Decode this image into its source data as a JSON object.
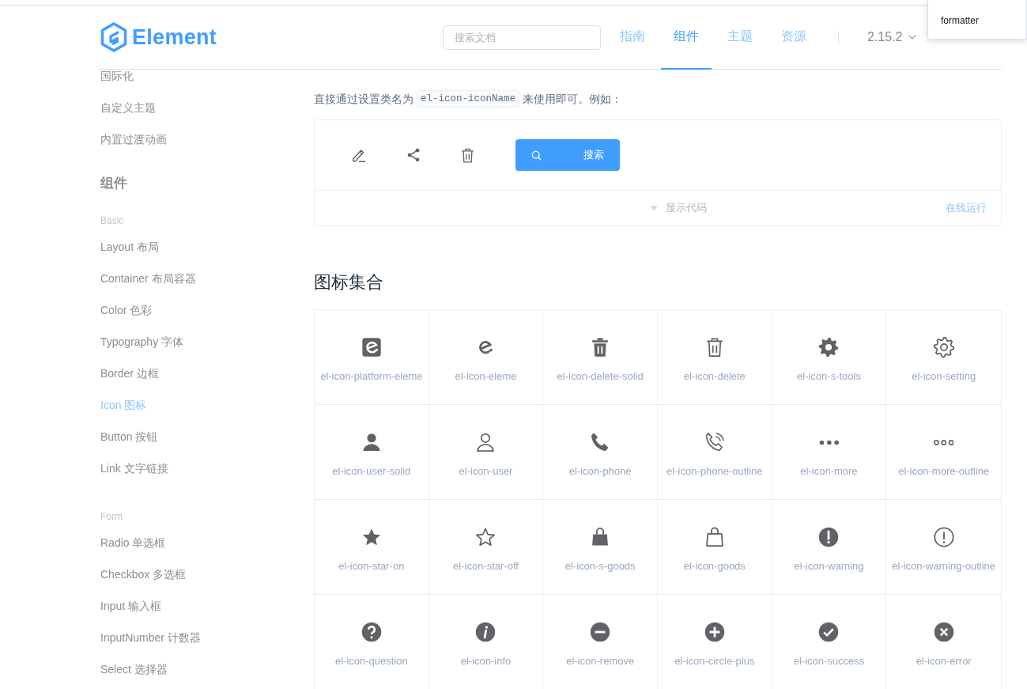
{
  "header": {
    "logo": "Element",
    "search": {
      "placeholder": "搜索文档"
    },
    "nav": [
      {
        "label": "指南",
        "selected": false
      },
      {
        "label": "组件",
        "selected": true
      },
      {
        "label": "主题",
        "selected": false
      },
      {
        "label": "资源",
        "selected": false
      }
    ],
    "version": "2.15.2"
  },
  "popup": {
    "text": "formatter"
  },
  "sidebar": {
    "items": [
      {
        "kind": "link",
        "label": "国际化",
        "selected": false
      },
      {
        "kind": "link",
        "label": "自定义主题",
        "selected": false
      },
      {
        "kind": "link",
        "label": "内置过渡动画",
        "selected": false
      },
      {
        "kind": "section",
        "label": "组件"
      },
      {
        "kind": "group",
        "label": "Basic"
      },
      {
        "kind": "link",
        "label": "Layout 布局",
        "selected": false
      },
      {
        "kind": "link",
        "label": "Container 布局容器",
        "selected": false
      },
      {
        "kind": "link",
        "label": "Color 色彩",
        "selected": false
      },
      {
        "kind": "link",
        "label": "Typography 字体",
        "selected": false
      },
      {
        "kind": "link",
        "label": "Border 边框",
        "selected": false
      },
      {
        "kind": "link",
        "label": "Icon 图标",
        "selected": true
      },
      {
        "kind": "link",
        "label": "Button 按钮",
        "selected": false
      },
      {
        "kind": "link",
        "label": "Link 文字链接",
        "selected": false
      },
      {
        "kind": "group",
        "label": "Form"
      },
      {
        "kind": "link",
        "label": "Radio 单选框",
        "selected": false
      },
      {
        "kind": "link",
        "label": "Checkbox 多选框",
        "selected": false
      },
      {
        "kind": "link",
        "label": "Input 输入框",
        "selected": false
      },
      {
        "kind": "link",
        "label": "InputNumber 计数器",
        "selected": false
      },
      {
        "kind": "link",
        "label": "Select 选择器",
        "selected": false
      }
    ]
  },
  "usage": {
    "text_before": "直接通过设置类名为",
    "code": "el-icon-iconName",
    "text_after": "来使用即可。例如："
  },
  "demo": {
    "button": "搜索",
    "show_code": "显示代码",
    "run_online": "在线运行"
  },
  "icon_section": {
    "title": "图标集合",
    "icons": [
      {
        "name": "el-icon-platform-eleme"
      },
      {
        "name": "el-icon-eleme"
      },
      {
        "name": "el-icon-delete-solid"
      },
      {
        "name": "el-icon-delete"
      },
      {
        "name": "el-icon-s-tools"
      },
      {
        "name": "el-icon-setting"
      },
      {
        "name": "el-icon-user-solid"
      },
      {
        "name": "el-icon-user"
      },
      {
        "name": "el-icon-phone"
      },
      {
        "name": "el-icon-phone-outline"
      },
      {
        "name": "el-icon-more"
      },
      {
        "name": "el-icon-more-outline"
      },
      {
        "name": "el-icon-star-on"
      },
      {
        "name": "el-icon-star-off"
      },
      {
        "name": "el-icon-s-goods"
      },
      {
        "name": "el-icon-goods"
      },
      {
        "name": "el-icon-warning"
      },
      {
        "name": "el-icon-warning-outline"
      },
      {
        "name": "el-icon-question"
      },
      {
        "name": "el-icon-info"
      },
      {
        "name": "el-icon-remove"
      },
      {
        "name": "el-icon-circle-plus"
      },
      {
        "name": "el-icon-success"
      },
      {
        "name": "el-icon-error"
      }
    ]
  }
}
